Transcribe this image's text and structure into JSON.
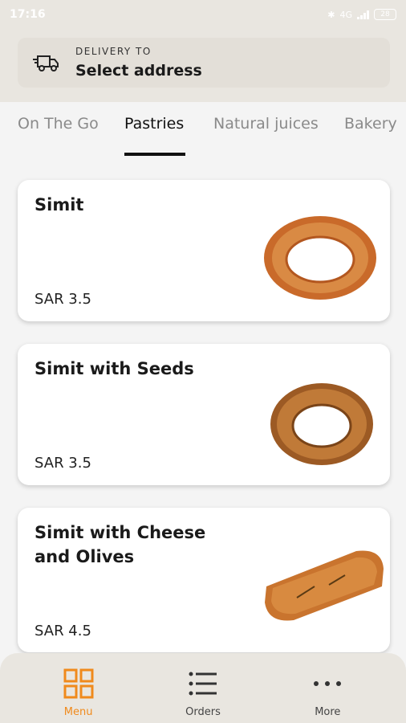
{
  "status_bar": {
    "time": "17:16",
    "signal_text": "4G",
    "battery": "28"
  },
  "header": {
    "delivery_label": "DELIVERY TO",
    "delivery_value": "Select address",
    "icon": "delivery-truck-icon"
  },
  "tabs": [
    {
      "label": "On The Go",
      "active": false
    },
    {
      "label": "Pastries",
      "active": true
    },
    {
      "label": "Natural juices",
      "active": false
    },
    {
      "label": "Bakery",
      "active": false
    }
  ],
  "products": [
    {
      "name": "Simit",
      "price": "SAR 3.5"
    },
    {
      "name": "Simit with Seeds",
      "price": "SAR 3.5"
    },
    {
      "name": "Simit with Cheese and Olives",
      "price": "SAR 4.5"
    }
  ],
  "bottom_nav": [
    {
      "label": "Menu",
      "icon": "grid-icon",
      "active": true
    },
    {
      "label": "Orders",
      "icon": "list-icon",
      "active": false
    },
    {
      "label": "More",
      "icon": "more-dots-icon",
      "active": false
    }
  ],
  "colors": {
    "accent": "#f08a1c",
    "header_bg": "#e9e6e0",
    "page_bg": "#f4f4f4"
  }
}
